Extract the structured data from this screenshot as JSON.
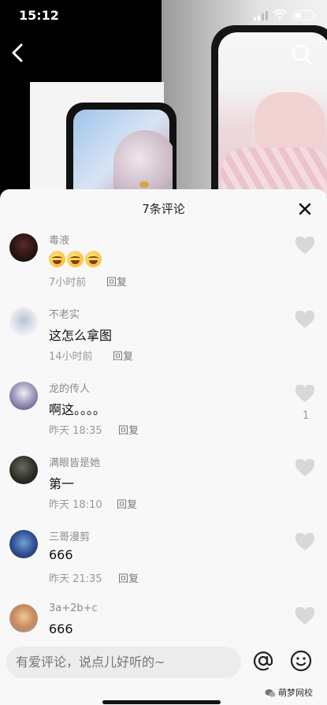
{
  "status_bar": {
    "time": "15:12",
    "battery_level": 0.35
  },
  "sheet": {
    "title": "7条评论"
  },
  "comments": [
    {
      "name": "毒液",
      "text": "",
      "emoji_count": 3,
      "time": "7小时前",
      "reply": "回复",
      "likes": ""
    },
    {
      "name": "不老实",
      "text": "这怎么拿图",
      "time": "14小时前",
      "reply": "回复",
      "likes": ""
    },
    {
      "name": "龙的传人",
      "text": "啊这。。。。",
      "time": "昨天 18:35",
      "reply": "回复",
      "likes": "1"
    },
    {
      "name": "满眼皆是她",
      "text": "第一",
      "time": "昨天 18:10",
      "reply": "回复",
      "likes": ""
    },
    {
      "name": "三哥漫剪",
      "text": "666",
      "time": "昨天 21:35",
      "reply": "回复",
      "likes": ""
    },
    {
      "name": "3a+2b+c",
      "text": "666",
      "time": "",
      "reply": "",
      "likes": ""
    }
  ],
  "input": {
    "placeholder": "有爱评论，说点儿好听的~"
  },
  "watermark": "萌梦网校",
  "icons": [
    "back-icon",
    "search-icon",
    "close-icon",
    "heart-icon",
    "at-icon",
    "emoji-icon"
  ]
}
